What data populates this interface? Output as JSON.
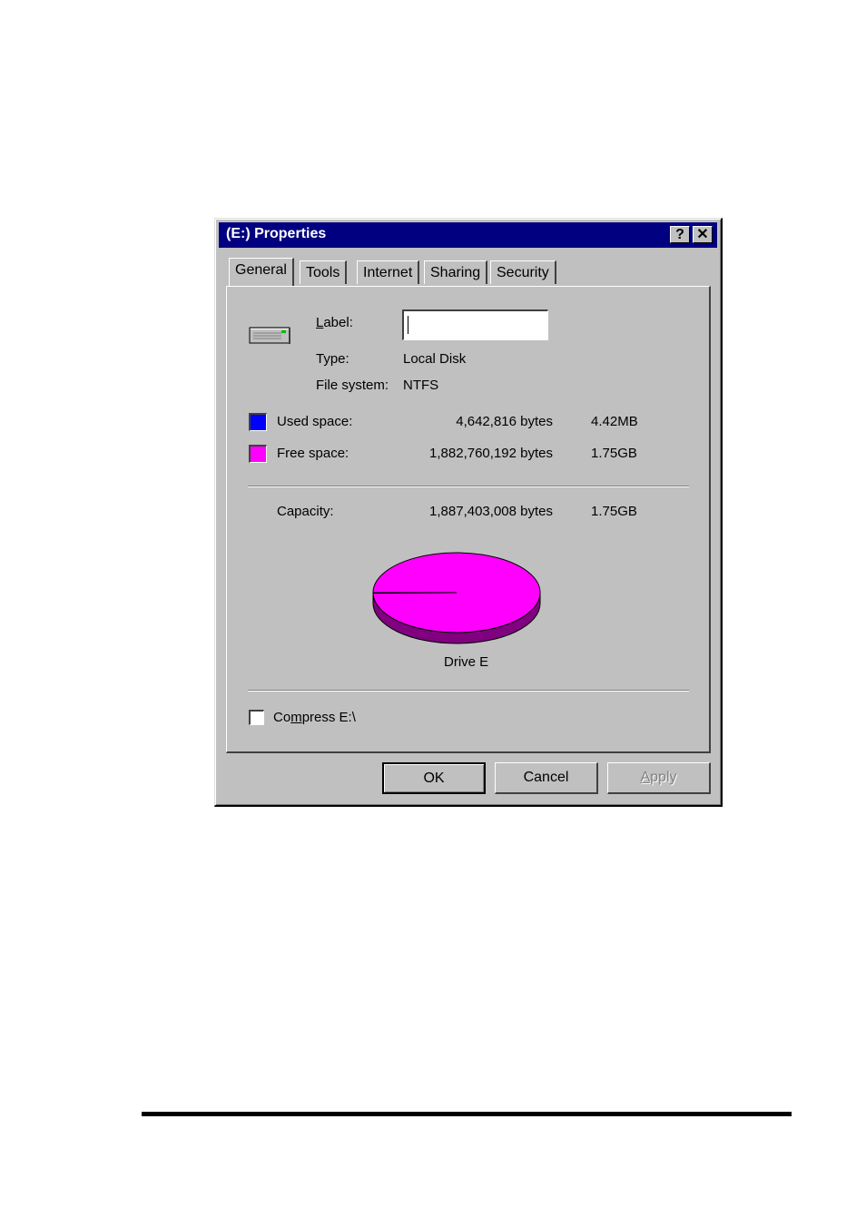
{
  "window": {
    "title": "(E:) Properties",
    "help_button": "?",
    "close_button": "✕"
  },
  "tabs": [
    {
      "label": "General",
      "active": true
    },
    {
      "label": "Tools",
      "active": false
    },
    {
      "label": "Internet",
      "active": false
    },
    {
      "label": "Sharing",
      "active": false
    },
    {
      "label": "Security",
      "active": false
    }
  ],
  "general": {
    "drive_icon": "hard-drive-icon",
    "label_field": {
      "label": "Label:",
      "mnemonic": "L",
      "value": ""
    },
    "type": {
      "label": "Type:",
      "value": "Local Disk"
    },
    "file_system": {
      "label": "File system:",
      "value": "NTFS"
    },
    "used_space": {
      "label": "Used space:",
      "bytes": "4,642,816 bytes",
      "size": "4.42MB",
      "color": "#0000ff"
    },
    "free_space": {
      "label": "Free space:",
      "bytes": "1,882,760,192 bytes",
      "size": "1.75GB",
      "color": "#ff00ff"
    },
    "capacity": {
      "label": "Capacity:",
      "bytes": "1,887,403,008 bytes",
      "size": "1.75GB"
    },
    "drive_caption": "Drive E",
    "compress": {
      "label_pre": "Co",
      "mnemonic": "m",
      "label_post": "press E:\\",
      "checked": false
    }
  },
  "buttons": {
    "ok": "OK",
    "cancel": "Cancel",
    "apply_mnemonic": "A",
    "apply_rest": "pply"
  },
  "chart_data": {
    "type": "pie",
    "title": "Drive E",
    "categories": [
      "Used space",
      "Free space"
    ],
    "values": [
      4642816,
      1882760192
    ],
    "colors": [
      "#0000ff",
      "#ff00ff"
    ],
    "side_colors": [
      "#000080",
      "#800080"
    ]
  }
}
